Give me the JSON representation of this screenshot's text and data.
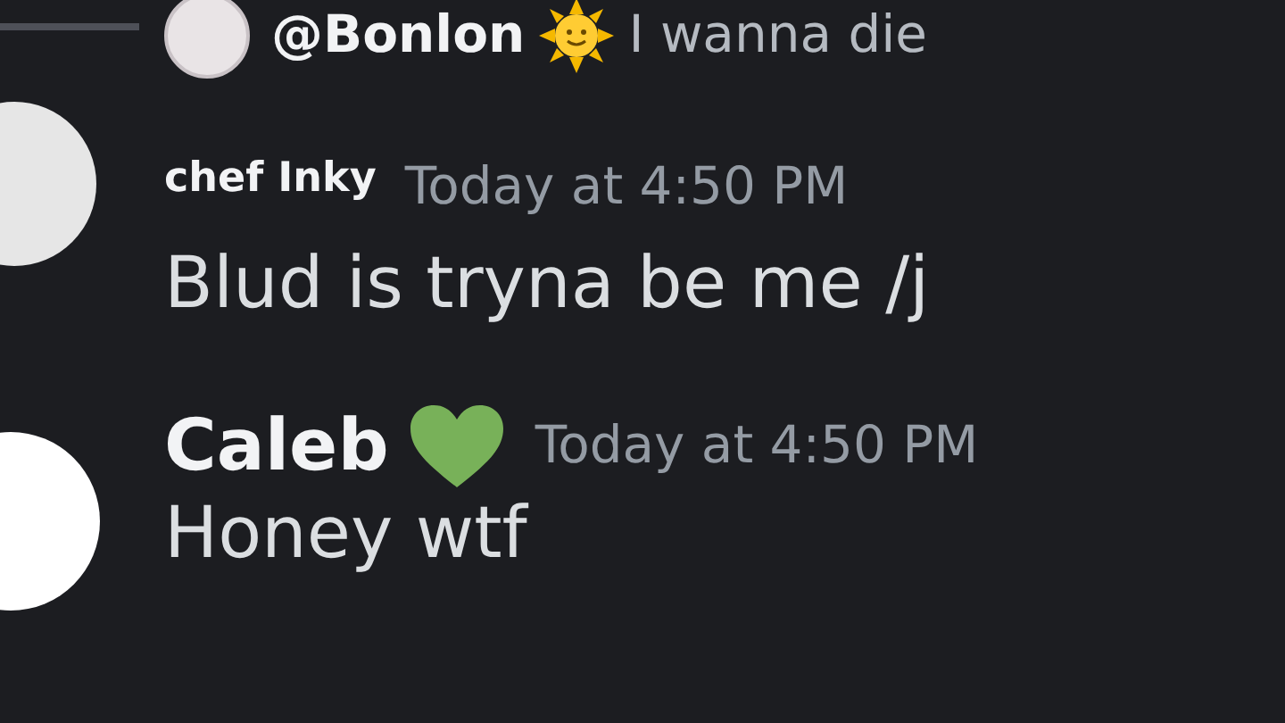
{
  "reply": {
    "author": "@Bonlon",
    "text": "I wanna die"
  },
  "messages": [
    {
      "author": "chef Inky",
      "timestamp": "Today at 4:50 PM",
      "text": "Blud is tryna be me /j",
      "kind": "plain"
    },
    {
      "author": "Caleb",
      "timestamp": "Today at 4:50 PM",
      "text": "Honey wtf",
      "kind": "hearted"
    }
  ]
}
